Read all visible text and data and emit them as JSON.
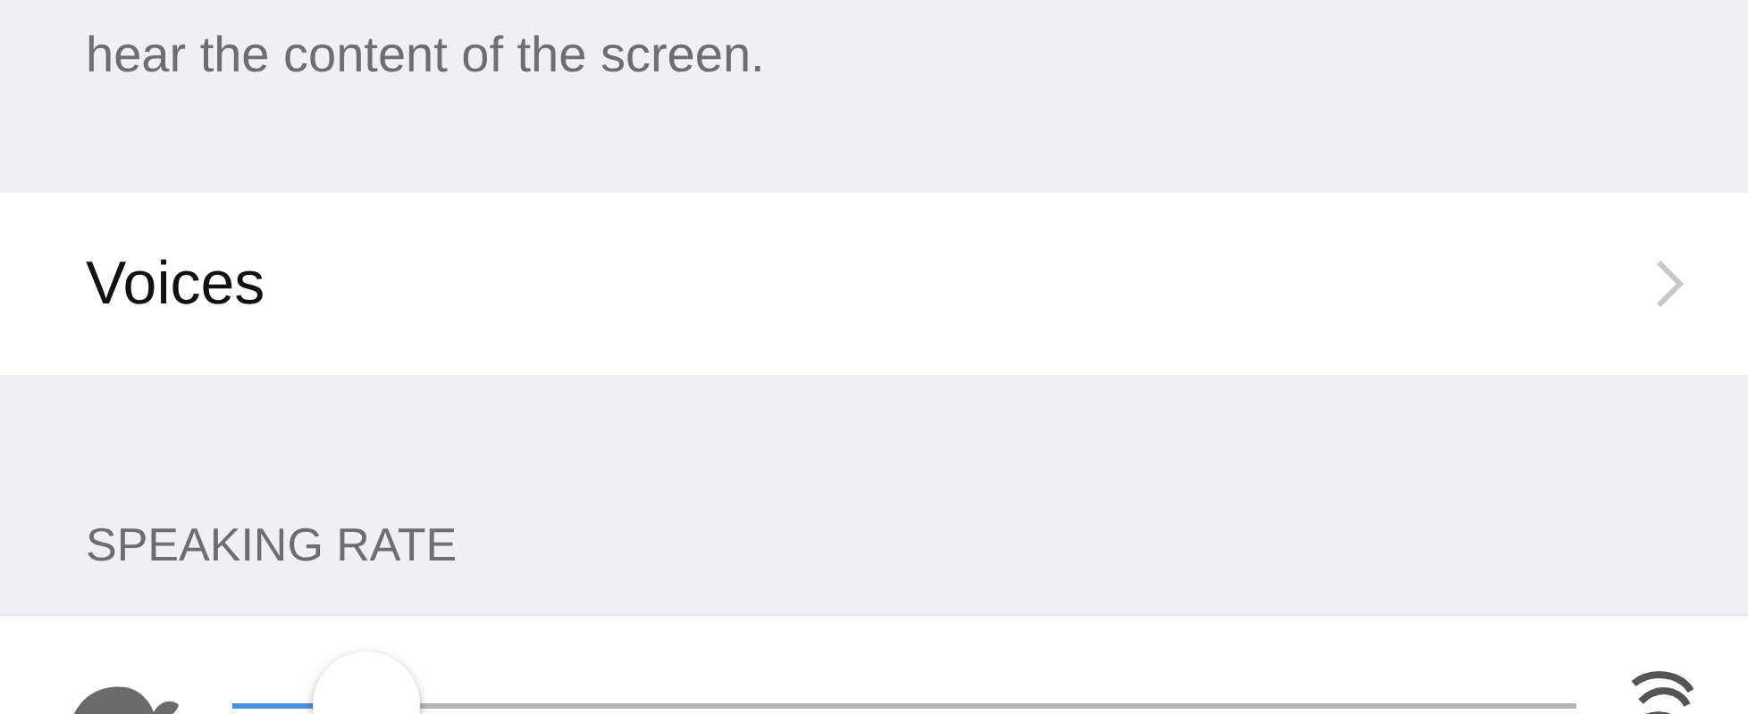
{
  "section_footer": "hear the content of the screen.",
  "voices_row": {
    "label": "Voices"
  },
  "speaking_rate": {
    "header": "SPEAKING RATE",
    "slider": {
      "level": 0.1
    }
  }
}
